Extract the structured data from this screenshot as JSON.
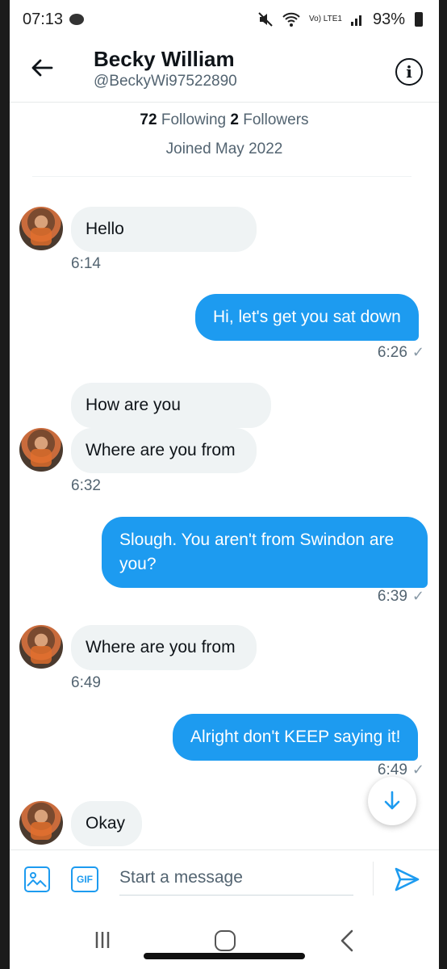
{
  "status_bar": {
    "time": "07:13",
    "lte_label": "Vo) LTE1",
    "battery": "93%"
  },
  "header": {
    "name": "Becky William",
    "handle": "@BeckyWi97522890",
    "info_glyph": "i"
  },
  "profile": {
    "following_count": "72",
    "following_label": "Following",
    "followers_count": "2",
    "followers_label": "Followers",
    "joined": "Joined May 2022"
  },
  "messages": [
    {
      "direction": "in",
      "text": "Hello",
      "time": "6:14"
    },
    {
      "direction": "out",
      "text": "Hi, let's get you sat down",
      "time": "6:26"
    },
    {
      "direction": "in",
      "text": "How are you"
    },
    {
      "direction": "in",
      "text": "Where are you from",
      "time": "6:32"
    },
    {
      "direction": "out",
      "text": "Slough. You aren't from Swindon are you?",
      "time": "6:39"
    },
    {
      "direction": "in",
      "text": "Where are you from",
      "time": "6:49"
    },
    {
      "direction": "out",
      "text": "Alright don't KEEP saying it!",
      "time": "6:49"
    },
    {
      "direction": "in",
      "text": "Okay"
    }
  ],
  "composer": {
    "placeholder": "Start a message",
    "gif_label": "GIF"
  },
  "colors": {
    "accent": "#1d9bf0",
    "incoming_bubble": "#eff3f4",
    "muted_text": "#536471"
  },
  "icons": [
    "back-arrow-icon",
    "info-icon",
    "image-icon",
    "gif-icon",
    "send-icon",
    "arrow-down-icon"
  ]
}
